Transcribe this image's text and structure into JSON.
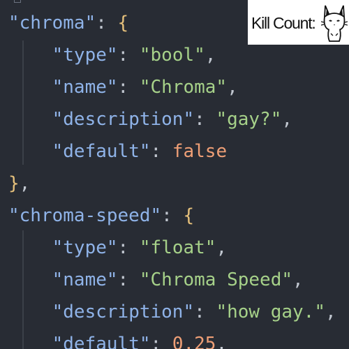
{
  "code": {
    "lines": [
      {
        "tokens": [
          {
            "t": "\"chroma\"",
            "c": "key"
          },
          {
            "t": ": ",
            "c": "punc"
          },
          {
            "t": "{",
            "c": "brace"
          }
        ]
      },
      {
        "tokens": [
          {
            "t": "    "
          },
          {
            "t": "\"type\"",
            "c": "key"
          },
          {
            "t": ": ",
            "c": "punc"
          },
          {
            "t": "\"bool\"",
            "c": "str"
          },
          {
            "t": ",",
            "c": "punc"
          }
        ]
      },
      {
        "tokens": [
          {
            "t": "    "
          },
          {
            "t": "\"name\"",
            "c": "key"
          },
          {
            "t": ": ",
            "c": "punc"
          },
          {
            "t": "\"Chroma\"",
            "c": "str"
          },
          {
            "t": ",",
            "c": "punc"
          }
        ]
      },
      {
        "tokens": [
          {
            "t": "    "
          },
          {
            "t": "\"description\"",
            "c": "key"
          },
          {
            "t": ": ",
            "c": "punc"
          },
          {
            "t": "\"gay?\"",
            "c": "str"
          },
          {
            "t": ",",
            "c": "punc"
          }
        ]
      },
      {
        "tokens": [
          {
            "t": "    "
          },
          {
            "t": "\"default\"",
            "c": "key"
          },
          {
            "t": ": ",
            "c": "punc"
          },
          {
            "t": "false",
            "c": "bool"
          }
        ]
      },
      {
        "tokens": [
          {
            "t": "}",
            "c": "brace"
          },
          {
            "t": ",",
            "c": "punc"
          }
        ]
      },
      {
        "tokens": [
          {
            "t": "\"chroma-speed\"",
            "c": "key"
          },
          {
            "t": ": ",
            "c": "punc"
          },
          {
            "t": "{",
            "c": "brace"
          }
        ]
      },
      {
        "tokens": [
          {
            "t": "    "
          },
          {
            "t": "\"type\"",
            "c": "key"
          },
          {
            "t": ": ",
            "c": "punc"
          },
          {
            "t": "\"float\"",
            "c": "str"
          },
          {
            "t": ",",
            "c": "punc"
          }
        ]
      },
      {
        "tokens": [
          {
            "t": "    "
          },
          {
            "t": "\"name\"",
            "c": "key"
          },
          {
            "t": ": ",
            "c": "punc"
          },
          {
            "t": "\"Chroma Speed\"",
            "c": "str"
          },
          {
            "t": ",",
            "c": "punc"
          }
        ]
      },
      {
        "tokens": [
          {
            "t": "    "
          },
          {
            "t": "\"description\"",
            "c": "key"
          },
          {
            "t": ": ",
            "c": "punc"
          },
          {
            "t": "\"how gay.\"",
            "c": "str"
          },
          {
            "t": ",",
            "c": "punc"
          }
        ]
      },
      {
        "tokens": [
          {
            "t": "    "
          },
          {
            "t": "\"default\"",
            "c": "key"
          },
          {
            "t": ": ",
            "c": "punc"
          },
          {
            "t": "0.25",
            "c": "num"
          },
          {
            "t": ",",
            "c": "punc"
          }
        ]
      }
    ]
  },
  "overlay": {
    "label": "Kill Count:",
    "icon": "cat-icon"
  },
  "colors": {
    "background": "#282c34",
    "key": "#8fb3e8",
    "string": "#a6d189",
    "brace": "#e5c07b",
    "literal": "#ef9f76",
    "punctuation": "#c0c6cf"
  }
}
